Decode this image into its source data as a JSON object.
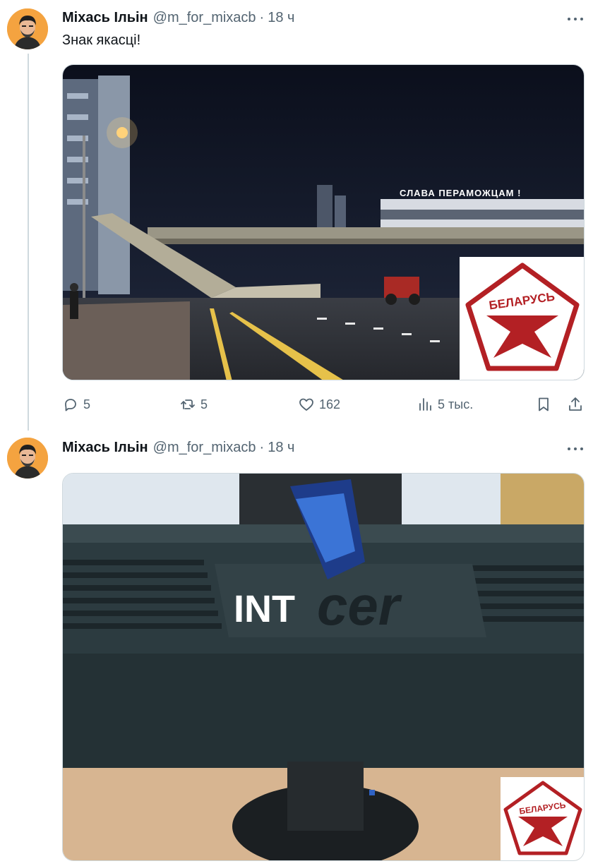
{
  "tweets": [
    {
      "author": {
        "name": "Міхась Ільін",
        "handle": "@m_for_mixacb"
      },
      "separator": "·",
      "time": "18 ч",
      "text": "Знак якасці!",
      "media": {
        "sign_text": "СЛАВА ПЕРАМОЖЦАМ !",
        "badge_text": "БЕЛАРУСЬ"
      },
      "stats": {
        "replies": "5",
        "retweets": "5",
        "likes": "162",
        "views": "5 тыс."
      }
    },
    {
      "author": {
        "name": "Міхась Ільін",
        "handle": "@m_for_mixacb"
      },
      "separator": "·",
      "time": "18 ч",
      "media": {
        "logo_text": "INT",
        "logo_text_2": "cer",
        "badge_text": "БЕЛАРУСЬ"
      }
    }
  ],
  "colors": {
    "badge_red": "#b32024",
    "muted": "#536471",
    "thread_line": "#cfd9de"
  }
}
